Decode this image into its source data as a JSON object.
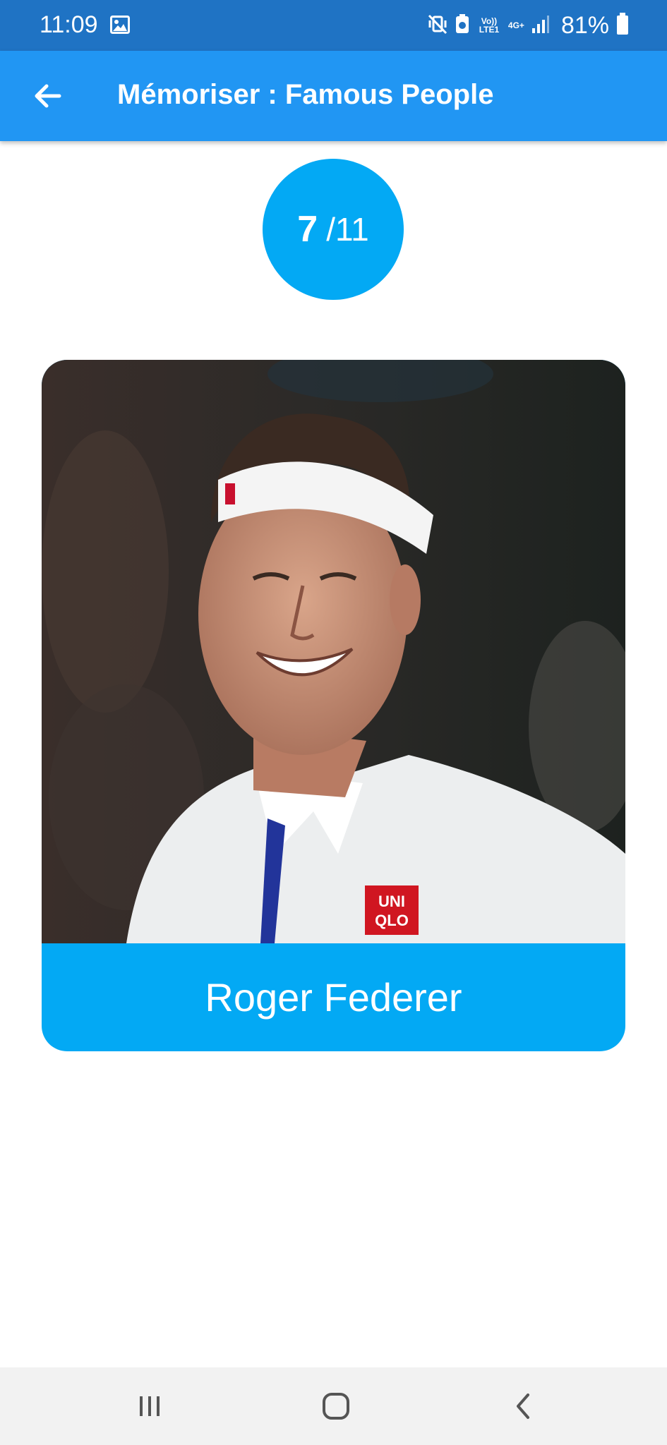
{
  "status_bar": {
    "time": "11:09",
    "battery_percent": "81%",
    "volte_label": "Vo)) LTE1",
    "network_label": "4G+",
    "icons": [
      "gallery-icon",
      "vibrate-mute-icon",
      "data-saver-icon",
      "volte-icon",
      "network-4g-icon",
      "signal-icon",
      "battery-icon"
    ],
    "background_color": "#1f73c4"
  },
  "app_bar": {
    "title": "Mémoriser : Famous People",
    "back_icon": "arrow-left-icon",
    "background_color": "#2196f3"
  },
  "progress": {
    "current": "7",
    "total": "/11",
    "color": "#03a9f4"
  },
  "card": {
    "name": "Roger Federer",
    "photo_subject": "Roger Federer portrait",
    "shirt_logo": "UNI QLO",
    "label_color": "#03a9f4"
  },
  "nav_bar": {
    "icons": [
      "recent-apps-icon",
      "home-icon",
      "back-icon"
    ]
  }
}
